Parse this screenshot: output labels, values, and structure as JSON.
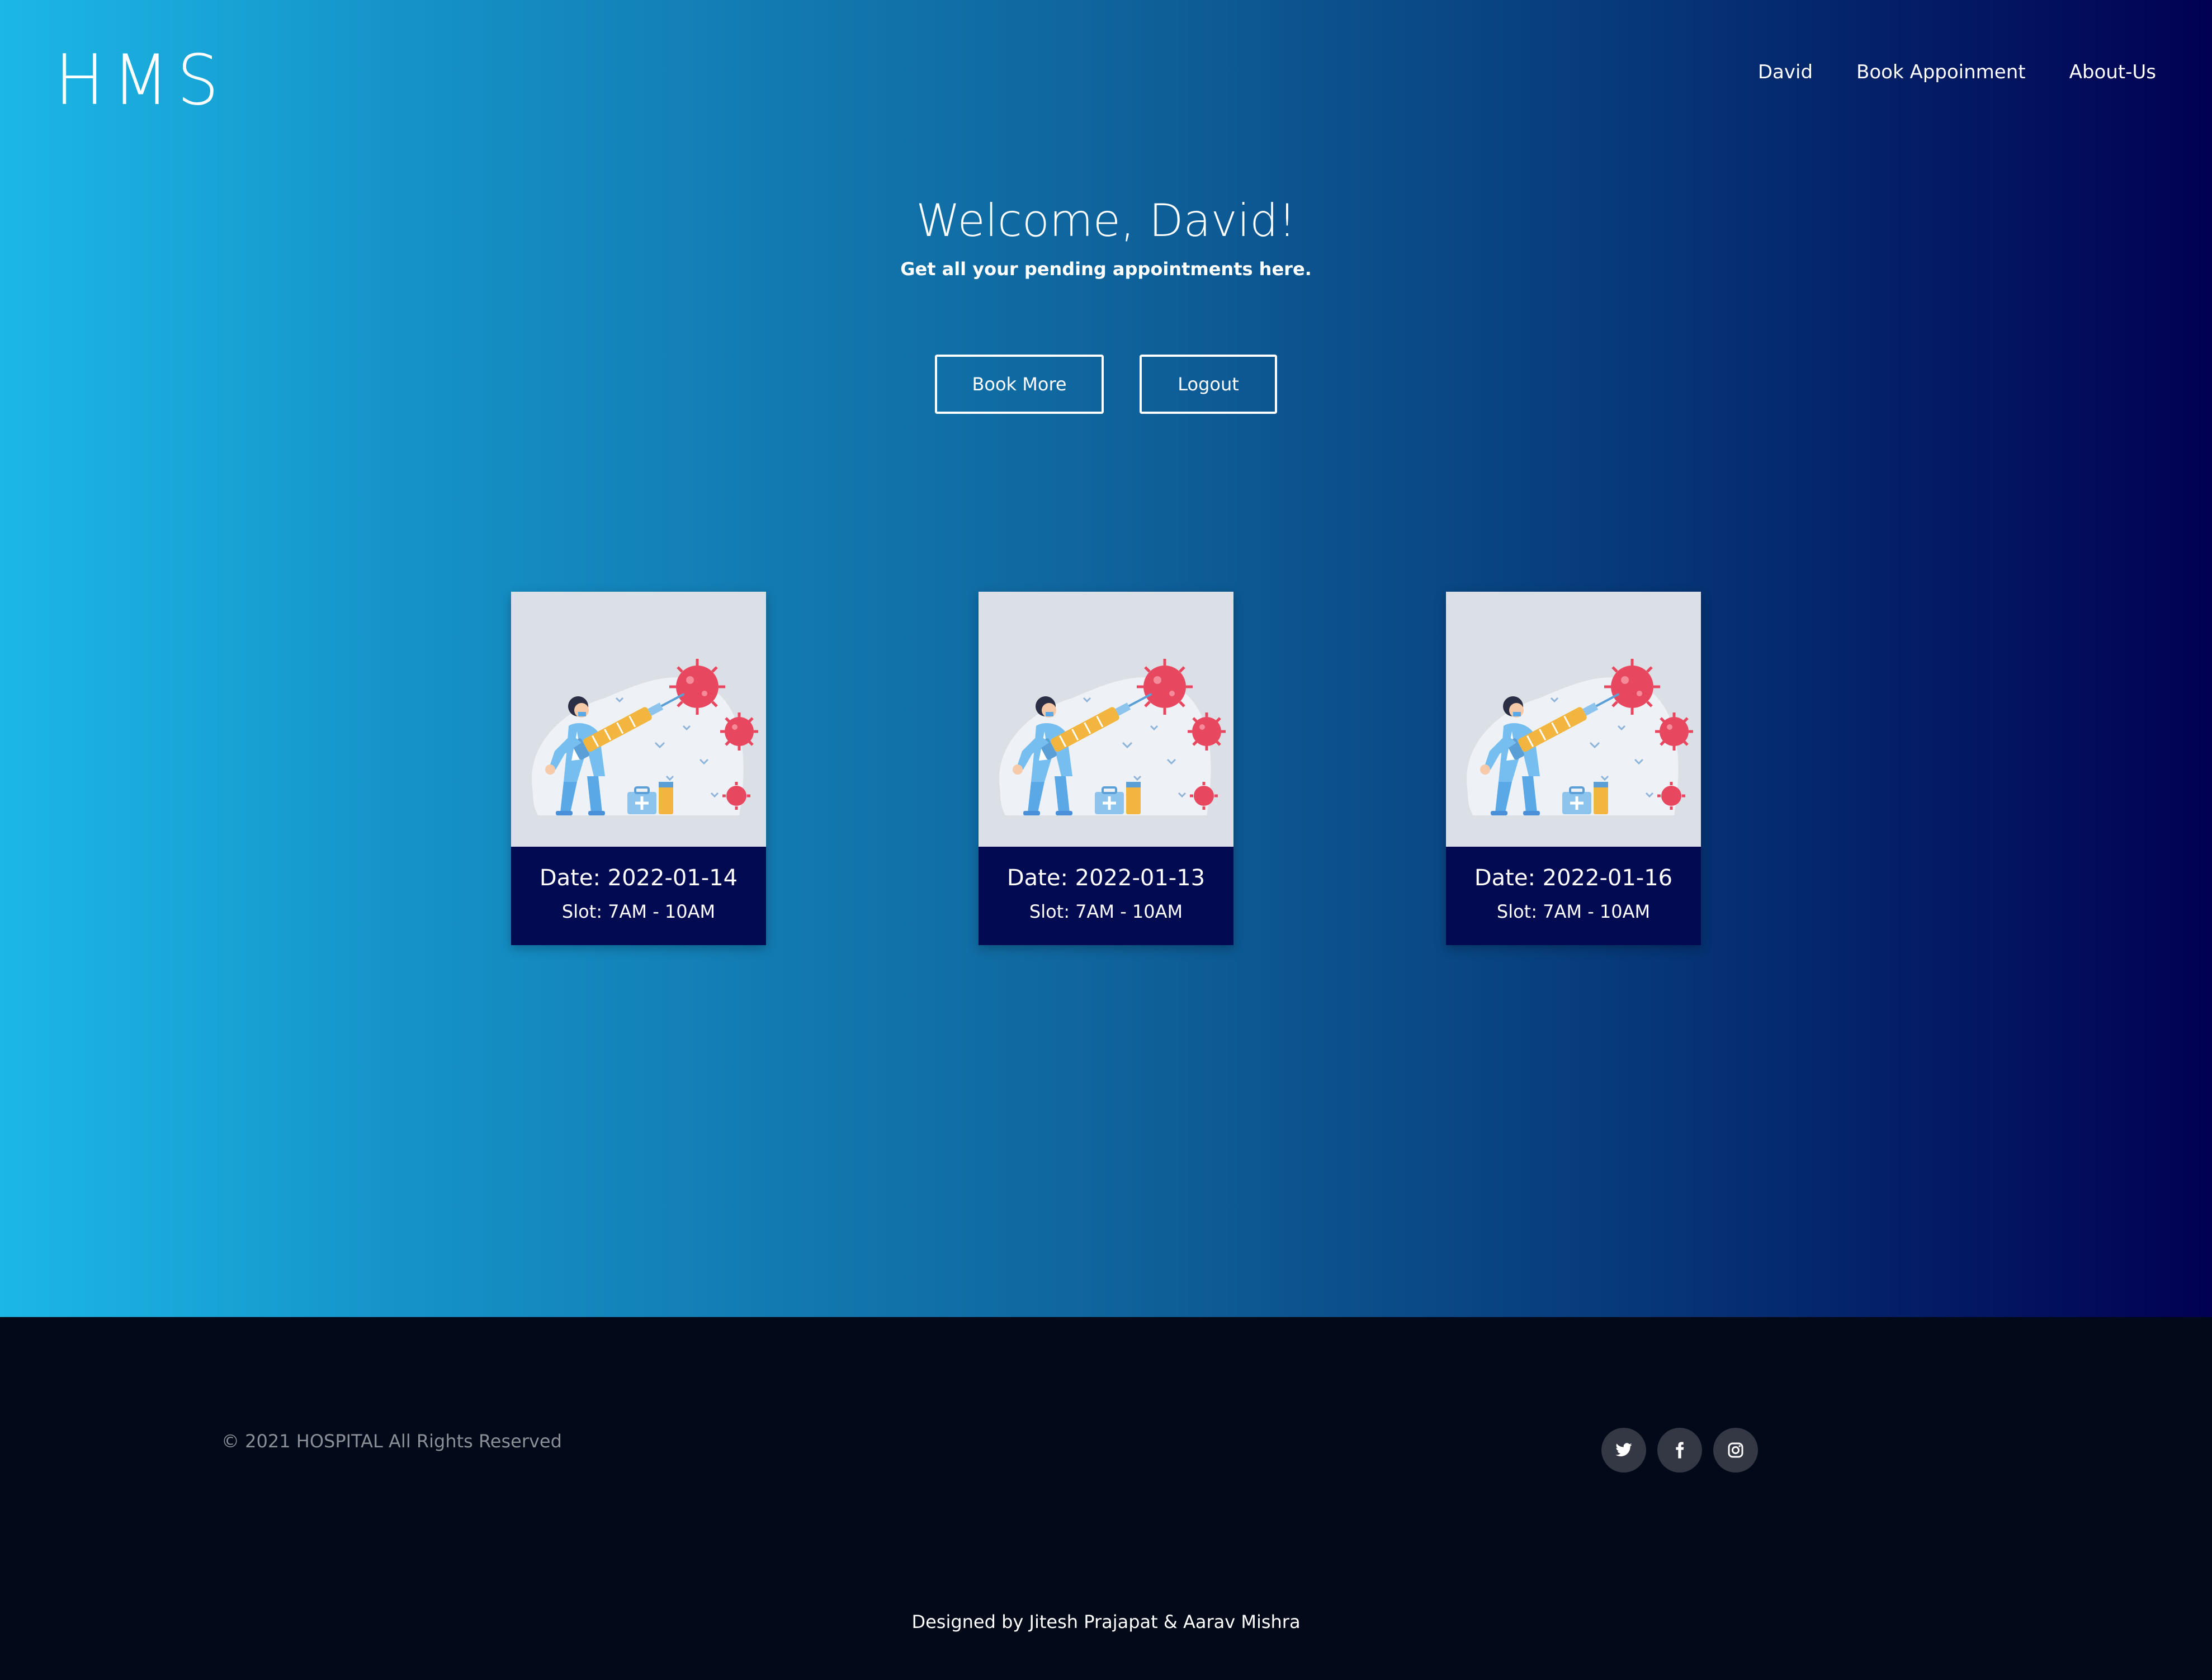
{
  "header": {
    "logo": "HMS",
    "nav": [
      "David",
      "Book Appoinment",
      "About-Us"
    ]
  },
  "hero": {
    "title": "Welcome, David!",
    "subtitle": "Get all your pending appointments here.",
    "book_more_label": "Book More",
    "logout_label": "Logout"
  },
  "appointments": [
    {
      "date": "Date: 2022-01-14",
      "slot": "Slot: 7AM - 10AM"
    },
    {
      "date": "Date: 2022-01-13",
      "slot": "Slot: 7AM - 10AM"
    },
    {
      "date": "Date: 2022-01-16",
      "slot": "Slot: 7AM - 10AM"
    }
  ],
  "footer": {
    "copyright": "© 2021 HOSPITAL All Rights Reserved",
    "socials": [
      "twitter-icon",
      "facebook-icon",
      "instagram-icon"
    ],
    "credits": "Designed by Jitesh Prajapat & Aarav Mishra"
  },
  "colors": {
    "gradient_start": "#1cb7e5",
    "gradient_end": "#010052",
    "card_footer": "#020b52",
    "footer_bg": "#020918",
    "virus": "#e8485f"
  }
}
